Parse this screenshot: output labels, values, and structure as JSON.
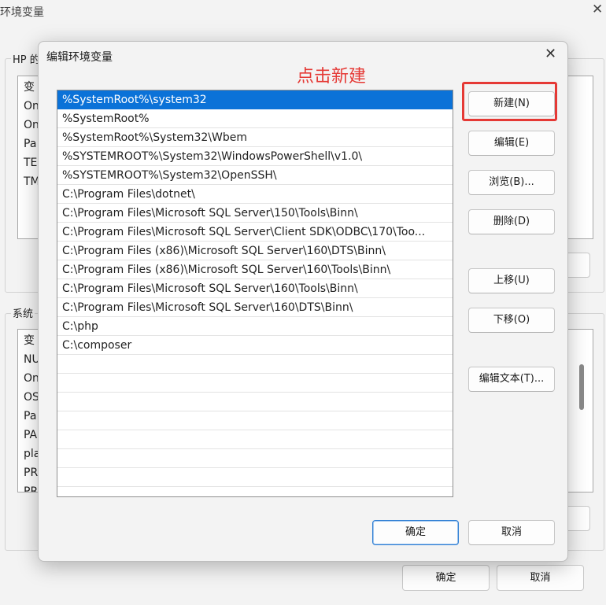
{
  "background_window": {
    "title": "环境变量",
    "user_group_label": "HP 的",
    "user_list_rows": [
      "变",
      "On",
      "On",
      "Pa",
      "TE",
      "TM"
    ],
    "system_group_label": "系统",
    "system_list_rows": [
      "变",
      "NU",
      "On",
      "OS",
      "Pa",
      "PA",
      "pla",
      "PR",
      "PR"
    ],
    "ok_label": "确定",
    "cancel_label": "取消"
  },
  "dialog": {
    "title": "编辑环境变量",
    "close_glyph": "✕",
    "annotation": "点击新建",
    "selected_index": 0,
    "paths": [
      "%SystemRoot%\\system32",
      "%SystemRoot%",
      "%SystemRoot%\\System32\\Wbem",
      "%SYSTEMROOT%\\System32\\WindowsPowerShell\\v1.0\\",
      "%SYSTEMROOT%\\System32\\OpenSSH\\",
      "C:\\Program Files\\dotnet\\",
      "C:\\Program Files\\Microsoft SQL Server\\150\\Tools\\Binn\\",
      "C:\\Program Files\\Microsoft SQL Server\\Client SDK\\ODBC\\170\\Too...",
      "C:\\Program Files (x86)\\Microsoft SQL Server\\160\\DTS\\Binn\\",
      "C:\\Program Files (x86)\\Microsoft SQL Server\\160\\Tools\\Binn\\",
      "C:\\Program Files\\Microsoft SQL Server\\160\\Tools\\Binn\\",
      "C:\\Program Files\\Microsoft SQL Server\\160\\DTS\\Binn\\",
      "C:\\php",
      "C:\\composer",
      "",
      "",
      "",
      "",
      "",
      "",
      "",
      ""
    ],
    "buttons": {
      "new": "新建(N)",
      "edit": "编辑(E)",
      "browse": "浏览(B)...",
      "delete": "删除(D)",
      "move_up": "上移(U)",
      "move_down": "下移(O)",
      "edit_text": "编辑文本(T)...",
      "ok": "确定",
      "cancel": "取消"
    }
  },
  "colors": {
    "selection": "#0b72d8",
    "annotation": "#e53935",
    "primary_border": "#2f7fd4"
  }
}
